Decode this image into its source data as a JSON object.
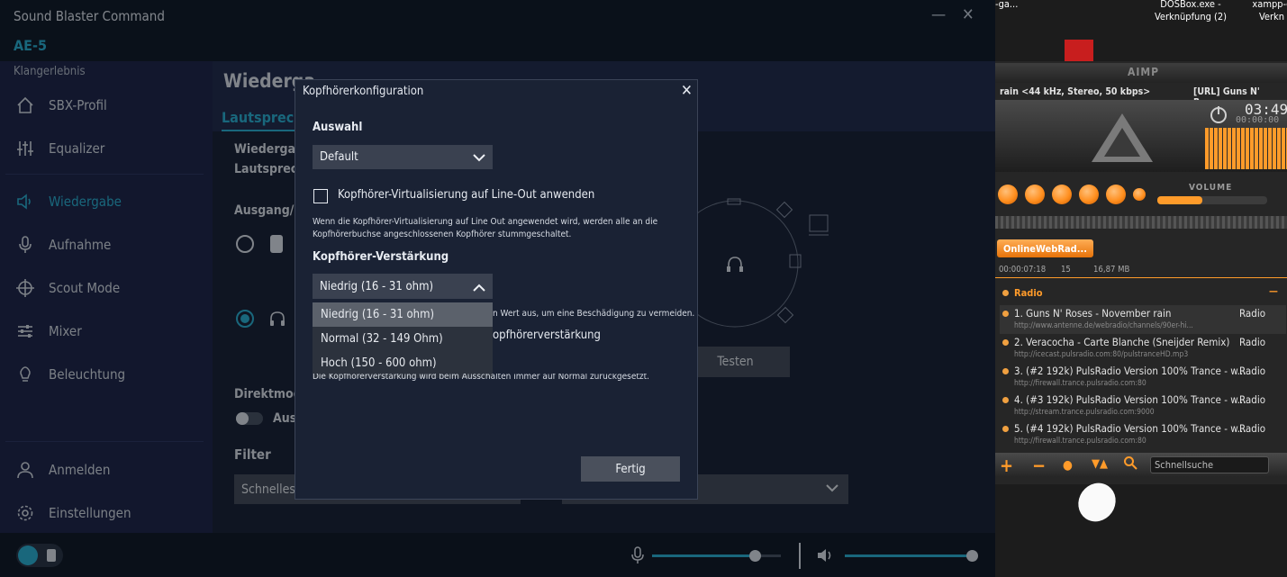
{
  "app": {
    "title": "Sound Blaster Command",
    "device": "AE-5",
    "minimize_glyph": "—",
    "close_glyph": "✕"
  },
  "sidebar": {
    "section_label": "Klangerlebnis",
    "items": [
      {
        "label": "SBX-Profil",
        "icon": "home-icon"
      },
      {
        "label": "Equalizer",
        "icon": "equalizer-icon"
      },
      {
        "label": "Wiedergabe",
        "icon": "speaker-icon",
        "active": true
      },
      {
        "label": "Aufnahme",
        "icon": "microphone-icon"
      },
      {
        "label": "Scout Mode",
        "icon": "crosshair-icon"
      },
      {
        "label": "Mixer",
        "icon": "mixer-icon"
      },
      {
        "label": "Beleuchtung",
        "icon": "lightbulb-icon"
      }
    ],
    "bottom_items": [
      {
        "label": "Anmelden",
        "icon": "user-icon"
      },
      {
        "label": "Einstellungen",
        "icon": "gear-icon"
      }
    ]
  },
  "content": {
    "heading": "Wiederga",
    "tab": "Lautsprech",
    "line1": "Wiedergab",
    "line2": "Lautsprech",
    "output_label": "Ausgang/O",
    "direct_mode": "Direktmodu",
    "direct_toggle_label": "Aus",
    "filter_label": "Filter",
    "filter_select": "Schnelles",
    "test_button": "Testen",
    "volume_note_tail": "n Wert aus, um eine Beschädigung zu vermeiden.",
    "virtual_tail": "opfhörerverstärkung"
  },
  "dialog": {
    "title": "Kopfhörerkonfiguration",
    "close_glyph": "✕",
    "selection_label": "Auswahl",
    "selection_value": "Default",
    "checkbox_label": "Kopfhörer-Virtualisierung auf Line-Out anwenden",
    "checkbox_checked": false,
    "note_line1": "Wenn die Kopfhörer-Virtualisierung auf Line Out angewendet wird, werden alle an die",
    "note_line2": "Kopfhörerbuchse angeschlossenen Kopfhörer stummgeschaltet.",
    "gain_label": "Kopfhörer-Verstärkung",
    "gain_value": "Niedrig (16 - 31 ohm)",
    "gain_options": [
      "Niedrig (16 - 31 ohm)",
      "Normal (32 - 149 Ohm)",
      "Hoch (150 - 600 ohm)"
    ],
    "reset_note": "Die Kopfhörerverstärkung wird beim Ausschalten immer auf Normal zurückgesetzt.",
    "done_button": "Fertig"
  },
  "bottombar": {
    "mic_level": 0.8,
    "volume_level": 1.0
  },
  "desktop": {
    "shortcut1": "-ga...",
    "shortcut2_line1": "DOSBox.exe -",
    "shortcut2_line2": "Verknüpfung (2)",
    "shortcut3_line1": "xampp-c",
    "shortcut3_line2": "Verkn"
  },
  "aimp": {
    "title": "AIMP",
    "stream_info": "rain <44 kHz, Stereo, 50 kbps>",
    "stream_right": "[URL] Guns N' Roses",
    "time": "03:49",
    "time_small": "00:00:00",
    "volume_label": "VOLUME",
    "tab": "OnlineWebRad...",
    "elapsed": "00:00:07:18",
    "count": "15",
    "size": "16,87 MB",
    "group": "Radio",
    "group_glyph": "—",
    "search_placeholder": "Schnellsuche",
    "playlist": [
      {
        "title": "1. Guns N' Roses - November rain",
        "url": "http://www.antenne.de/webradio/channels/90er-hi...",
        "tag": "Radio"
      },
      {
        "title": "2. Veracocha - Carte Blanche (Sneijder Remix)",
        "url": "http://icecast.pulsradio.com:80/pulstranceHD.mp3",
        "tag": "Radio"
      },
      {
        "title": "3. (#2 192k) PulsRadio Version 100% Trance - w...",
        "url": "http://firewall.trance.pulsradio.com:80",
        "tag": "Radio"
      },
      {
        "title": "4. (#3 192k) PulsRadio Version 100% Trance - w...",
        "url": "http://stream.trance.pulsradio.com:9000",
        "tag": "Radio"
      },
      {
        "title": "5. (#4 192k) PulsRadio Version 100% Trance - w...",
        "url": "http://firewall.trance.pulsradio.com:80",
        "tag": "Radio"
      }
    ]
  }
}
